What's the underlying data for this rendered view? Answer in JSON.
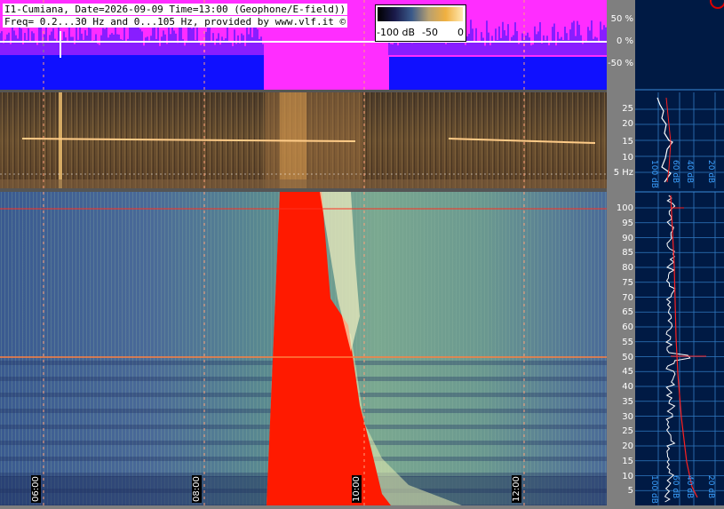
{
  "info": {
    "line1": "I1-Cumiana, Date=2026-09-09 Time=13:00 (Geophone/E-field))",
    "line2": "Freq= 0.2...30 Hz and 0...105 Hz, provided by www.vlf.it ©"
  },
  "legend": {
    "low": "-100 dB",
    "mid": "-50",
    "high": "0"
  },
  "waveform_ticks": [
    "50 %",
    "0 %",
    "-50 %"
  ],
  "mid_ticks": [
    "25",
    "20",
    "15",
    "10",
    "5 Hz"
  ],
  "main_ticks": [
    "100",
    "95",
    "90",
    "85",
    "80",
    "75",
    "70",
    "65",
    "60",
    "55",
    "50",
    "45",
    "40",
    "35",
    "30",
    "25",
    "20",
    "15",
    "10",
    "5"
  ],
  "time_labels": [
    "06:00",
    "08:00",
    "10:00",
    "12:00"
  ],
  "side_db_top": [
    "100 dB",
    "60 dB",
    "40 dB",
    "20 dB"
  ],
  "side_db_bottom": [
    "100 dB",
    "60 dB",
    "40 dB",
    "20 dB"
  ],
  "colors": {
    "magenta": "#ff2dff",
    "blue": "#1010ff",
    "hot": "#ff1a00",
    "grid": "#3a8ad8"
  }
}
